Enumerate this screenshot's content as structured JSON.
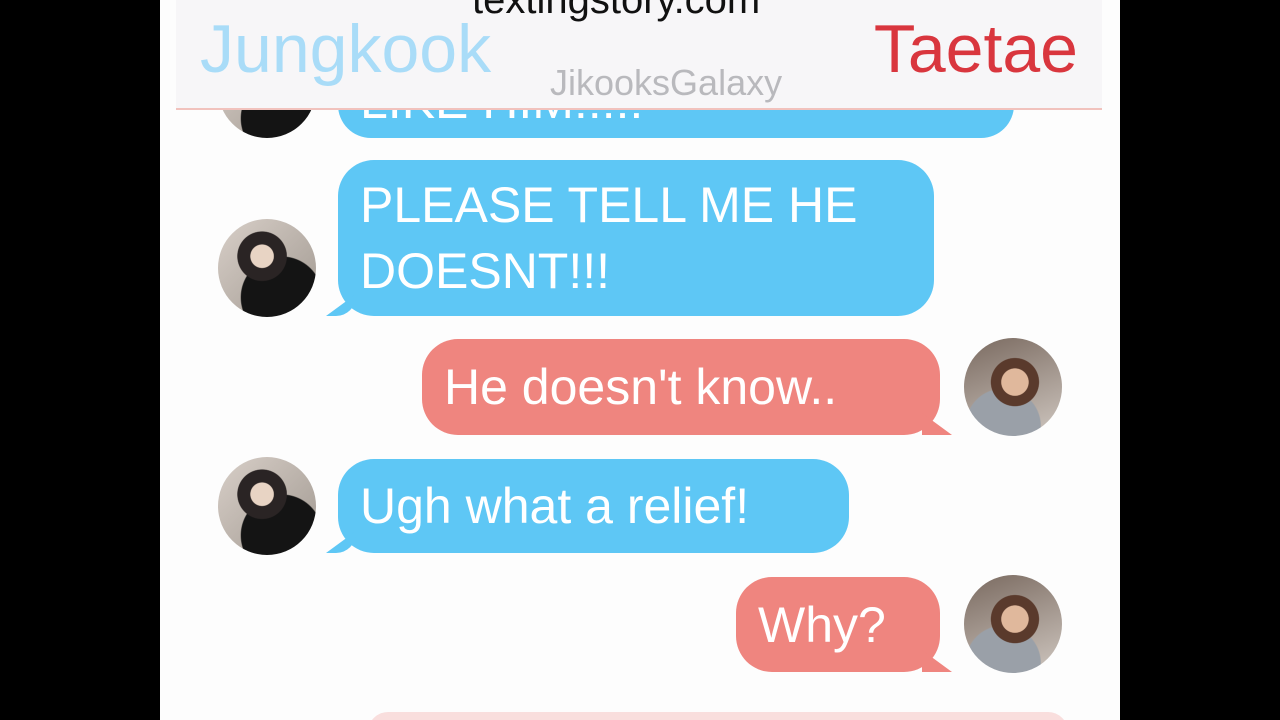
{
  "header": {
    "watermark_top": "textingstory.com",
    "contact_left": "Jungkook",
    "contact_right": "Taetae",
    "watermark_mid": "JikooksGalaxy"
  },
  "messages": [
    {
      "sender": "Jungkook",
      "side": "left",
      "text": "LIKE HIM!!!!!"
    },
    {
      "sender": "Jungkook",
      "side": "left",
      "line1": "PLEASE TELL ME HE",
      "line2": "DOESNT!!!"
    },
    {
      "sender": "Taetae",
      "side": "right",
      "text": "He doesn't know.."
    },
    {
      "sender": "Jungkook",
      "side": "left",
      "text": "Ugh what a relief!"
    },
    {
      "sender": "Taetae",
      "side": "right",
      "text": "Why?"
    }
  ],
  "colors": {
    "left_bubble": "#5ec7f5",
    "right_bubble": "#ef857f",
    "left_name": "#a9dcf8",
    "right_name": "#d9363e"
  },
  "icons": {
    "left_avatar": "jungkook-avatar",
    "right_avatar": "taetae-avatar"
  }
}
